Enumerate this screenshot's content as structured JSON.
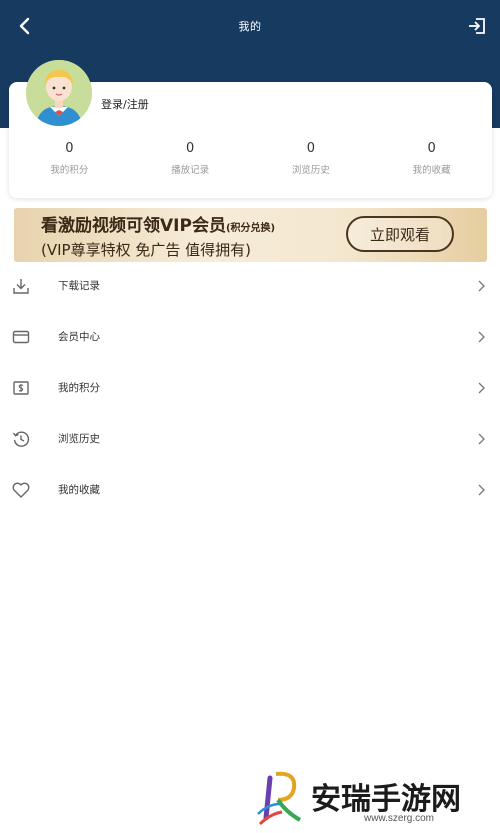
{
  "header": {
    "title": "我的"
  },
  "profile": {
    "login_label": "登录/注册",
    "stats": [
      {
        "value": "0",
        "label": "我的积分"
      },
      {
        "value": "0",
        "label": "播放记录"
      },
      {
        "value": "0",
        "label": "浏览历史"
      },
      {
        "value": "0",
        "label": "我的收藏"
      }
    ]
  },
  "banner": {
    "title": "看激励视频可领VIP会员",
    "title_note": "(积分兑换)",
    "subtitle": "(VIP尊享特权 免广告 值得拥有)",
    "button_label": "立即观看"
  },
  "menu": {
    "items": [
      {
        "label": "下载记录",
        "icon": "download-icon"
      },
      {
        "label": "会员中心",
        "icon": "card-icon"
      },
      {
        "label": "我的积分",
        "icon": "points-icon"
      },
      {
        "label": "浏览历史",
        "icon": "history-icon"
      },
      {
        "label": "我的收藏",
        "icon": "heart-icon"
      }
    ]
  },
  "watermark": {
    "name": "安瑞手游网",
    "url": "www.szerg.com"
  },
  "colors": {
    "header_bg": "#173a60",
    "banner_text": "#3b2817",
    "icon_gray": "#666666"
  }
}
